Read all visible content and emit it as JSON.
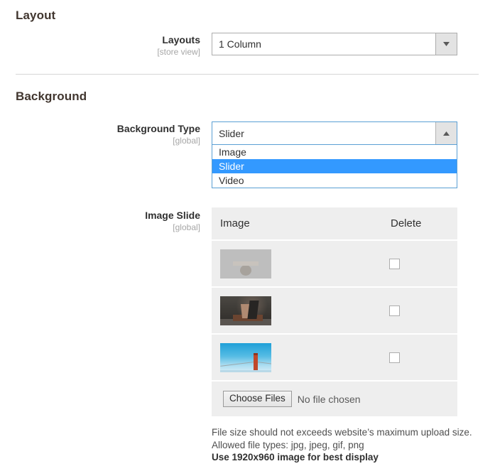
{
  "sections": {
    "layout": {
      "title": "Layout",
      "layouts_field": {
        "label": "Layouts",
        "scope": "[store view]",
        "value": "1 Column",
        "arrow_icon": "chevron-down-icon"
      }
    },
    "background": {
      "title": "Background",
      "background_type_field": {
        "label": "Background Type",
        "scope": "[global]",
        "value": "Slider",
        "arrow_icon": "chevron-up-icon",
        "expanded": true,
        "options": [
          {
            "label": "Image",
            "selected": false
          },
          {
            "label": "Slider",
            "selected": true
          },
          {
            "label": "Video",
            "selected": false
          }
        ]
      },
      "image_slide_field": {
        "label": "Image Slide",
        "scope": "[global]",
        "columns": {
          "image": "Image",
          "delete": "Delete"
        },
        "rows": [
          {
            "thumb": "blank-product-thumbnail",
            "delete_checked": false
          },
          {
            "thumb": "dark-studio-portrait-thumbnail",
            "delete_checked": false
          },
          {
            "thumb": "golden-gate-bridge-thumbnail",
            "delete_checked": false
          }
        ],
        "upload": {
          "button_label": "Choose Files",
          "status": "No file chosen"
        },
        "notes": [
          {
            "text": "File size should not exceeds website’s maximum upload size.",
            "bold": false
          },
          {
            "text": "Allowed file types: jpg, jpeg, gif, png",
            "bold": false
          },
          {
            "text": "Use 1920x960 image for best display",
            "bold": true
          }
        ]
      }
    }
  },
  "colors": {
    "highlight": "#3399ff",
    "focus_border": "#5a9fd4",
    "panel": "#eeeeee"
  }
}
